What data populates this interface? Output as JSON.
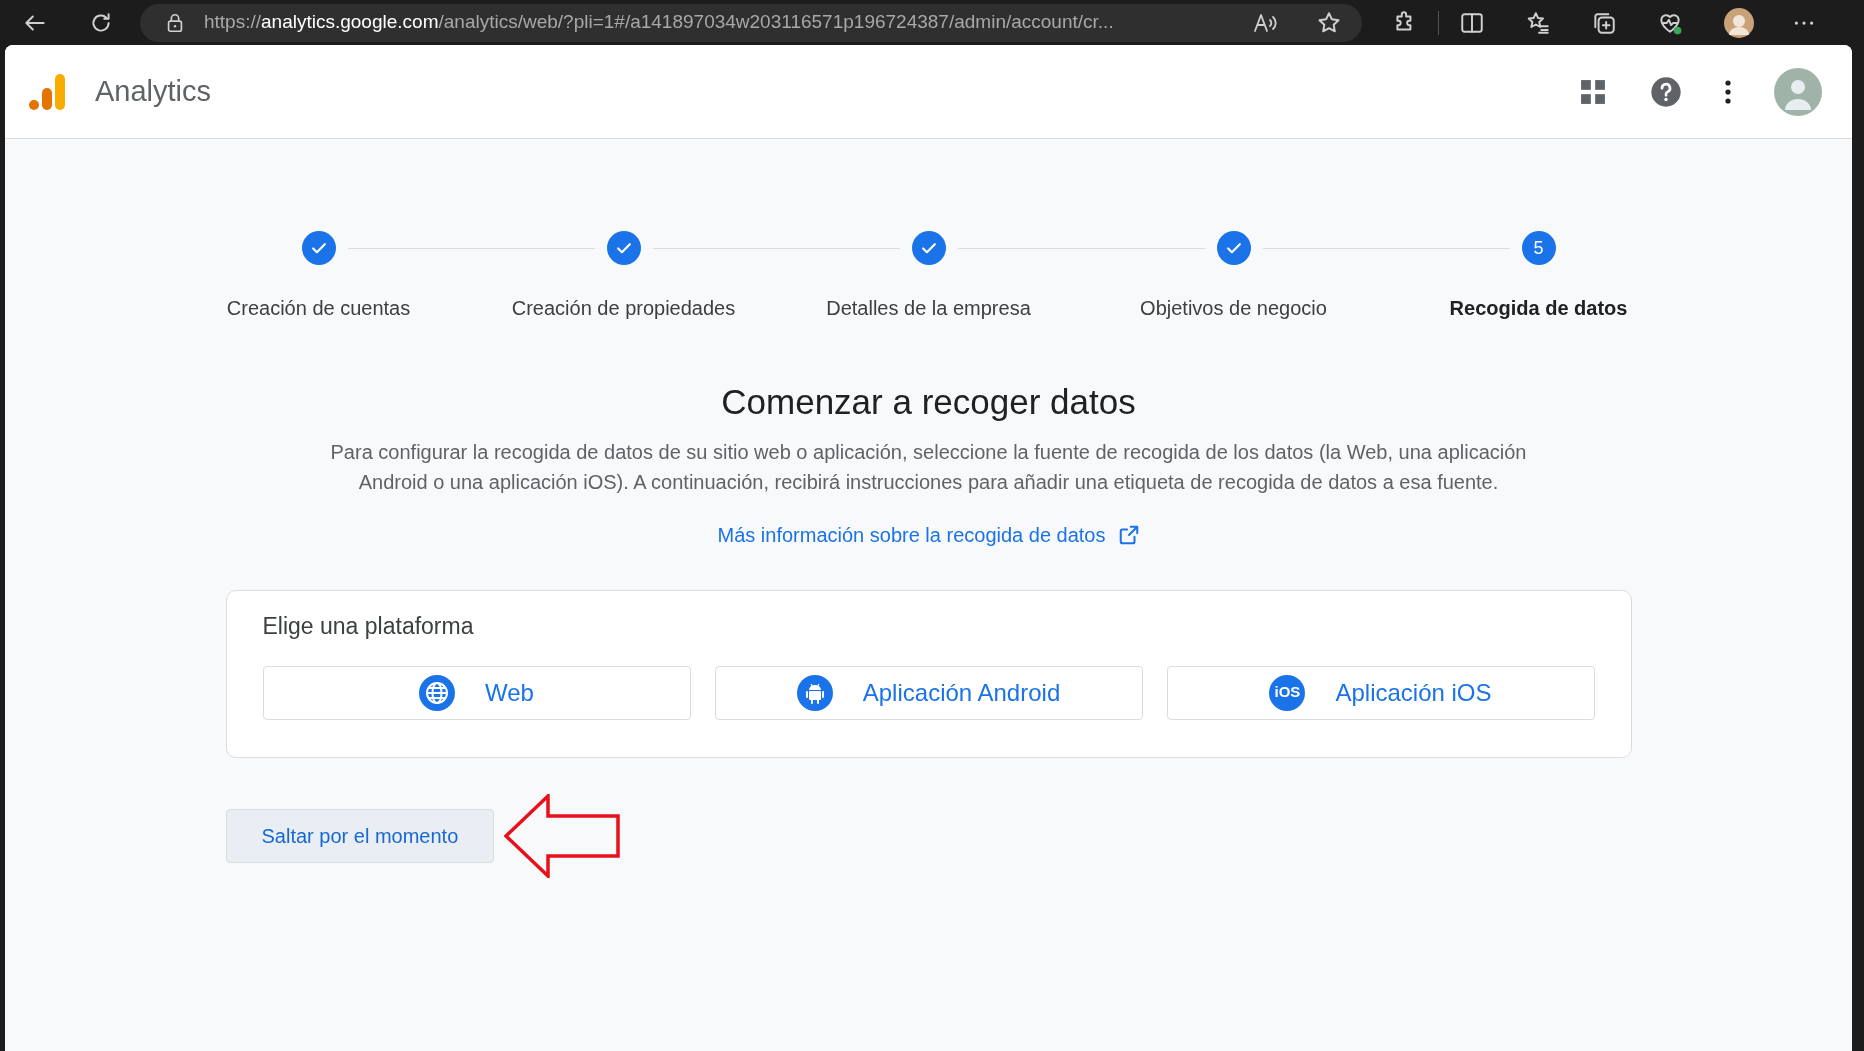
{
  "browser": {
    "url": "https://**analytics.google.com**/analytics/web/?pli=1#/a141897034w203116571p196724387/admin/account/cr..."
  },
  "app": {
    "name": "Analytics"
  },
  "steps": [
    {
      "label": "Creación de cuentas",
      "completed": true,
      "selected": false
    },
    {
      "label": "Creación de propiedades",
      "completed": true,
      "selected": false
    },
    {
      "label": "Detalles de la empresa",
      "completed": true,
      "selected": false
    },
    {
      "label": "Objetivos de negocio",
      "completed": true,
      "selected": false
    },
    {
      "label": "Recogida de datos",
      "number": "5",
      "completed": false,
      "selected": true
    }
  ],
  "heading": "Comenzar a recoger datos",
  "description": "Para configurar la recogida de datos de su sitio web o aplicación, seleccione la fuente de recogida de los datos (la Web, una aplicación Android o una aplicación iOS). A continuación, recibirá instrucciones para añadir una etiqueta de recogida de datos a esa fuente.",
  "learn_more_link": "Más información sobre la recogida de datos",
  "platform_card": {
    "title": "Elige una plataforma",
    "platforms": [
      {
        "kind": "web",
        "label": "Web"
      },
      {
        "kind": "android",
        "label": "Aplicación Android"
      },
      {
        "kind": "ios",
        "label": "Aplicación iOS",
        "icon_text": "iOS"
      }
    ]
  },
  "skip_button": "Saltar por el momento"
}
